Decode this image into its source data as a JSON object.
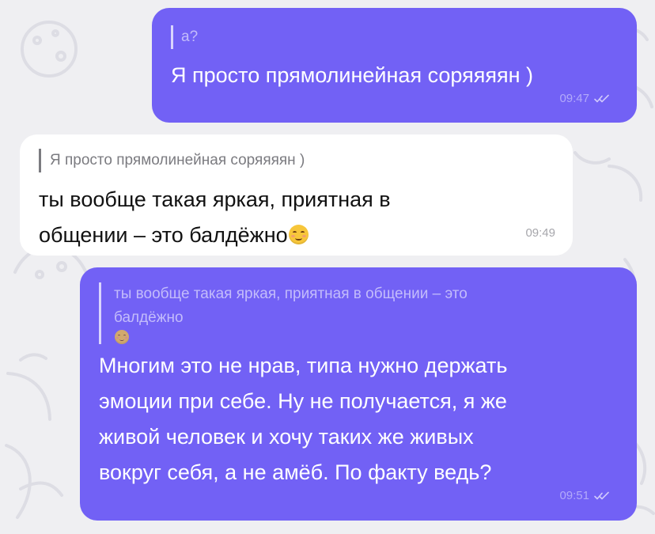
{
  "messages": [
    {
      "direction": "outgoing",
      "reply": {
        "lines": [
          "а?"
        ]
      },
      "text_lines": [
        "Я просто прямолинейная соряяяян )"
      ],
      "time": "09:47",
      "status": "read-double-check"
    },
    {
      "direction": "incoming",
      "reply": {
        "lines": [
          "Я просто прямолинейная соряяяян )"
        ]
      },
      "text_lines": [
        "ты вообще такая яркая, приятная в",
        "общении – это балдёжно"
      ],
      "emoji": "relieved-face",
      "time": "09:49"
    },
    {
      "direction": "outgoing",
      "reply": {
        "lines": [
          "ты вообще такая яркая, приятная в общении – это",
          "балдёжно"
        ],
        "emoji": "relieved-face"
      },
      "text_lines": [
        "Многим это не нрав, типа нужно держать",
        "эмоции при себе. Ну не получается, я же",
        "живой человек и хочу таких же живых",
        "вокруг себя, а не амёб. По факту ведь?"
      ],
      "time": "09:51",
      "status": "read-double-check"
    }
  ],
  "colors": {
    "background": "#efeff2",
    "outgoing_bubble": "#7261f5",
    "incoming_bubble": "#ffffff",
    "outgoing_text": "#ffffff",
    "incoming_text": "#111111"
  }
}
